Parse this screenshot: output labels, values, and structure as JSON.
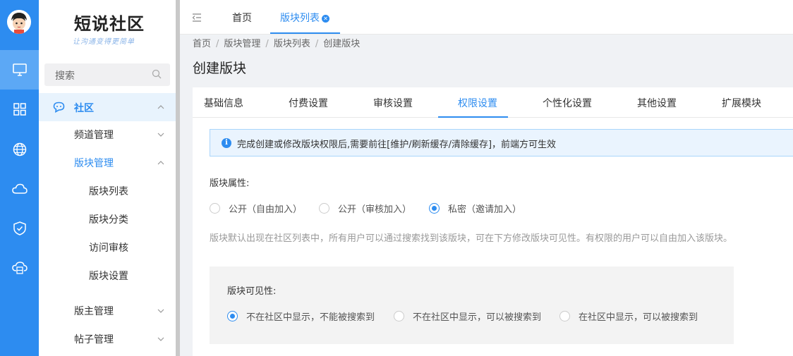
{
  "app": {
    "logo_title": "短说社区",
    "logo_subtitle": "让沟通变得更简单"
  },
  "rail": {
    "items": [
      {
        "icon": "monitor-icon",
        "active": true
      },
      {
        "icon": "grid-icon",
        "active": false
      },
      {
        "icon": "globe-icon",
        "active": false
      },
      {
        "icon": "cloud-icon",
        "active": false
      },
      {
        "icon": "shield-check-icon",
        "active": false
      },
      {
        "icon": "cloud-server-icon",
        "active": false
      }
    ]
  },
  "sidebar": {
    "search_placeholder": "搜索",
    "group": {
      "label": "社区",
      "icon": "chat-bubble-icon",
      "expanded": true
    },
    "items": [
      {
        "label": "频道管理",
        "expanded": false
      },
      {
        "label": "版块管理",
        "expanded": true,
        "active": true
      },
      {
        "label": "版主管理",
        "expanded": false
      },
      {
        "label": "帖子管理",
        "expanded": false
      }
    ],
    "leaves": [
      "版块列表",
      "版块分类",
      "访问审核",
      "版块设置"
    ]
  },
  "topbar": {
    "tabs": [
      {
        "label": "首页",
        "active": false
      },
      {
        "label": "版块列表",
        "active": true,
        "closable": true
      }
    ]
  },
  "breadcrumb": [
    "首页",
    "版块管理",
    "版块列表",
    "创建版块"
  ],
  "page_title": "创建版块",
  "content_tabs": [
    "基础信息",
    "付费设置",
    "审核设置",
    "权限设置",
    "个性化设置",
    "其他设置",
    "扩展模块"
  ],
  "active_content_tab": "权限设置",
  "alert": {
    "text": "完成创建或修改版块权限后,需要前往[维护/刷新缓存/清除缓存]，前端方可生效"
  },
  "attribute": {
    "label": "版块属性:",
    "options": [
      "公开（自由加入）",
      "公开（审核加入）",
      "私密（邀请加入）"
    ],
    "selected": "私密（邀请加入）",
    "hint": "版块默认出现在社区列表中，所有用户可以通过搜索找到该版块，可在下方修改版块可见性。有权限的用户可以自由加入该版块。"
  },
  "visibility": {
    "label": "版块可见性:",
    "options": [
      "不在社区中显示，不能被搜索到",
      "不在社区中显示，可以被搜索到",
      "在社区中显示，可以被搜索到"
    ],
    "selected": "不在社区中显示，不能被搜索到"
  },
  "colors": {
    "accent": "#2d8cf0",
    "rail_bg": "#2d8cf0",
    "alert_bg": "#eaf4fe"
  }
}
